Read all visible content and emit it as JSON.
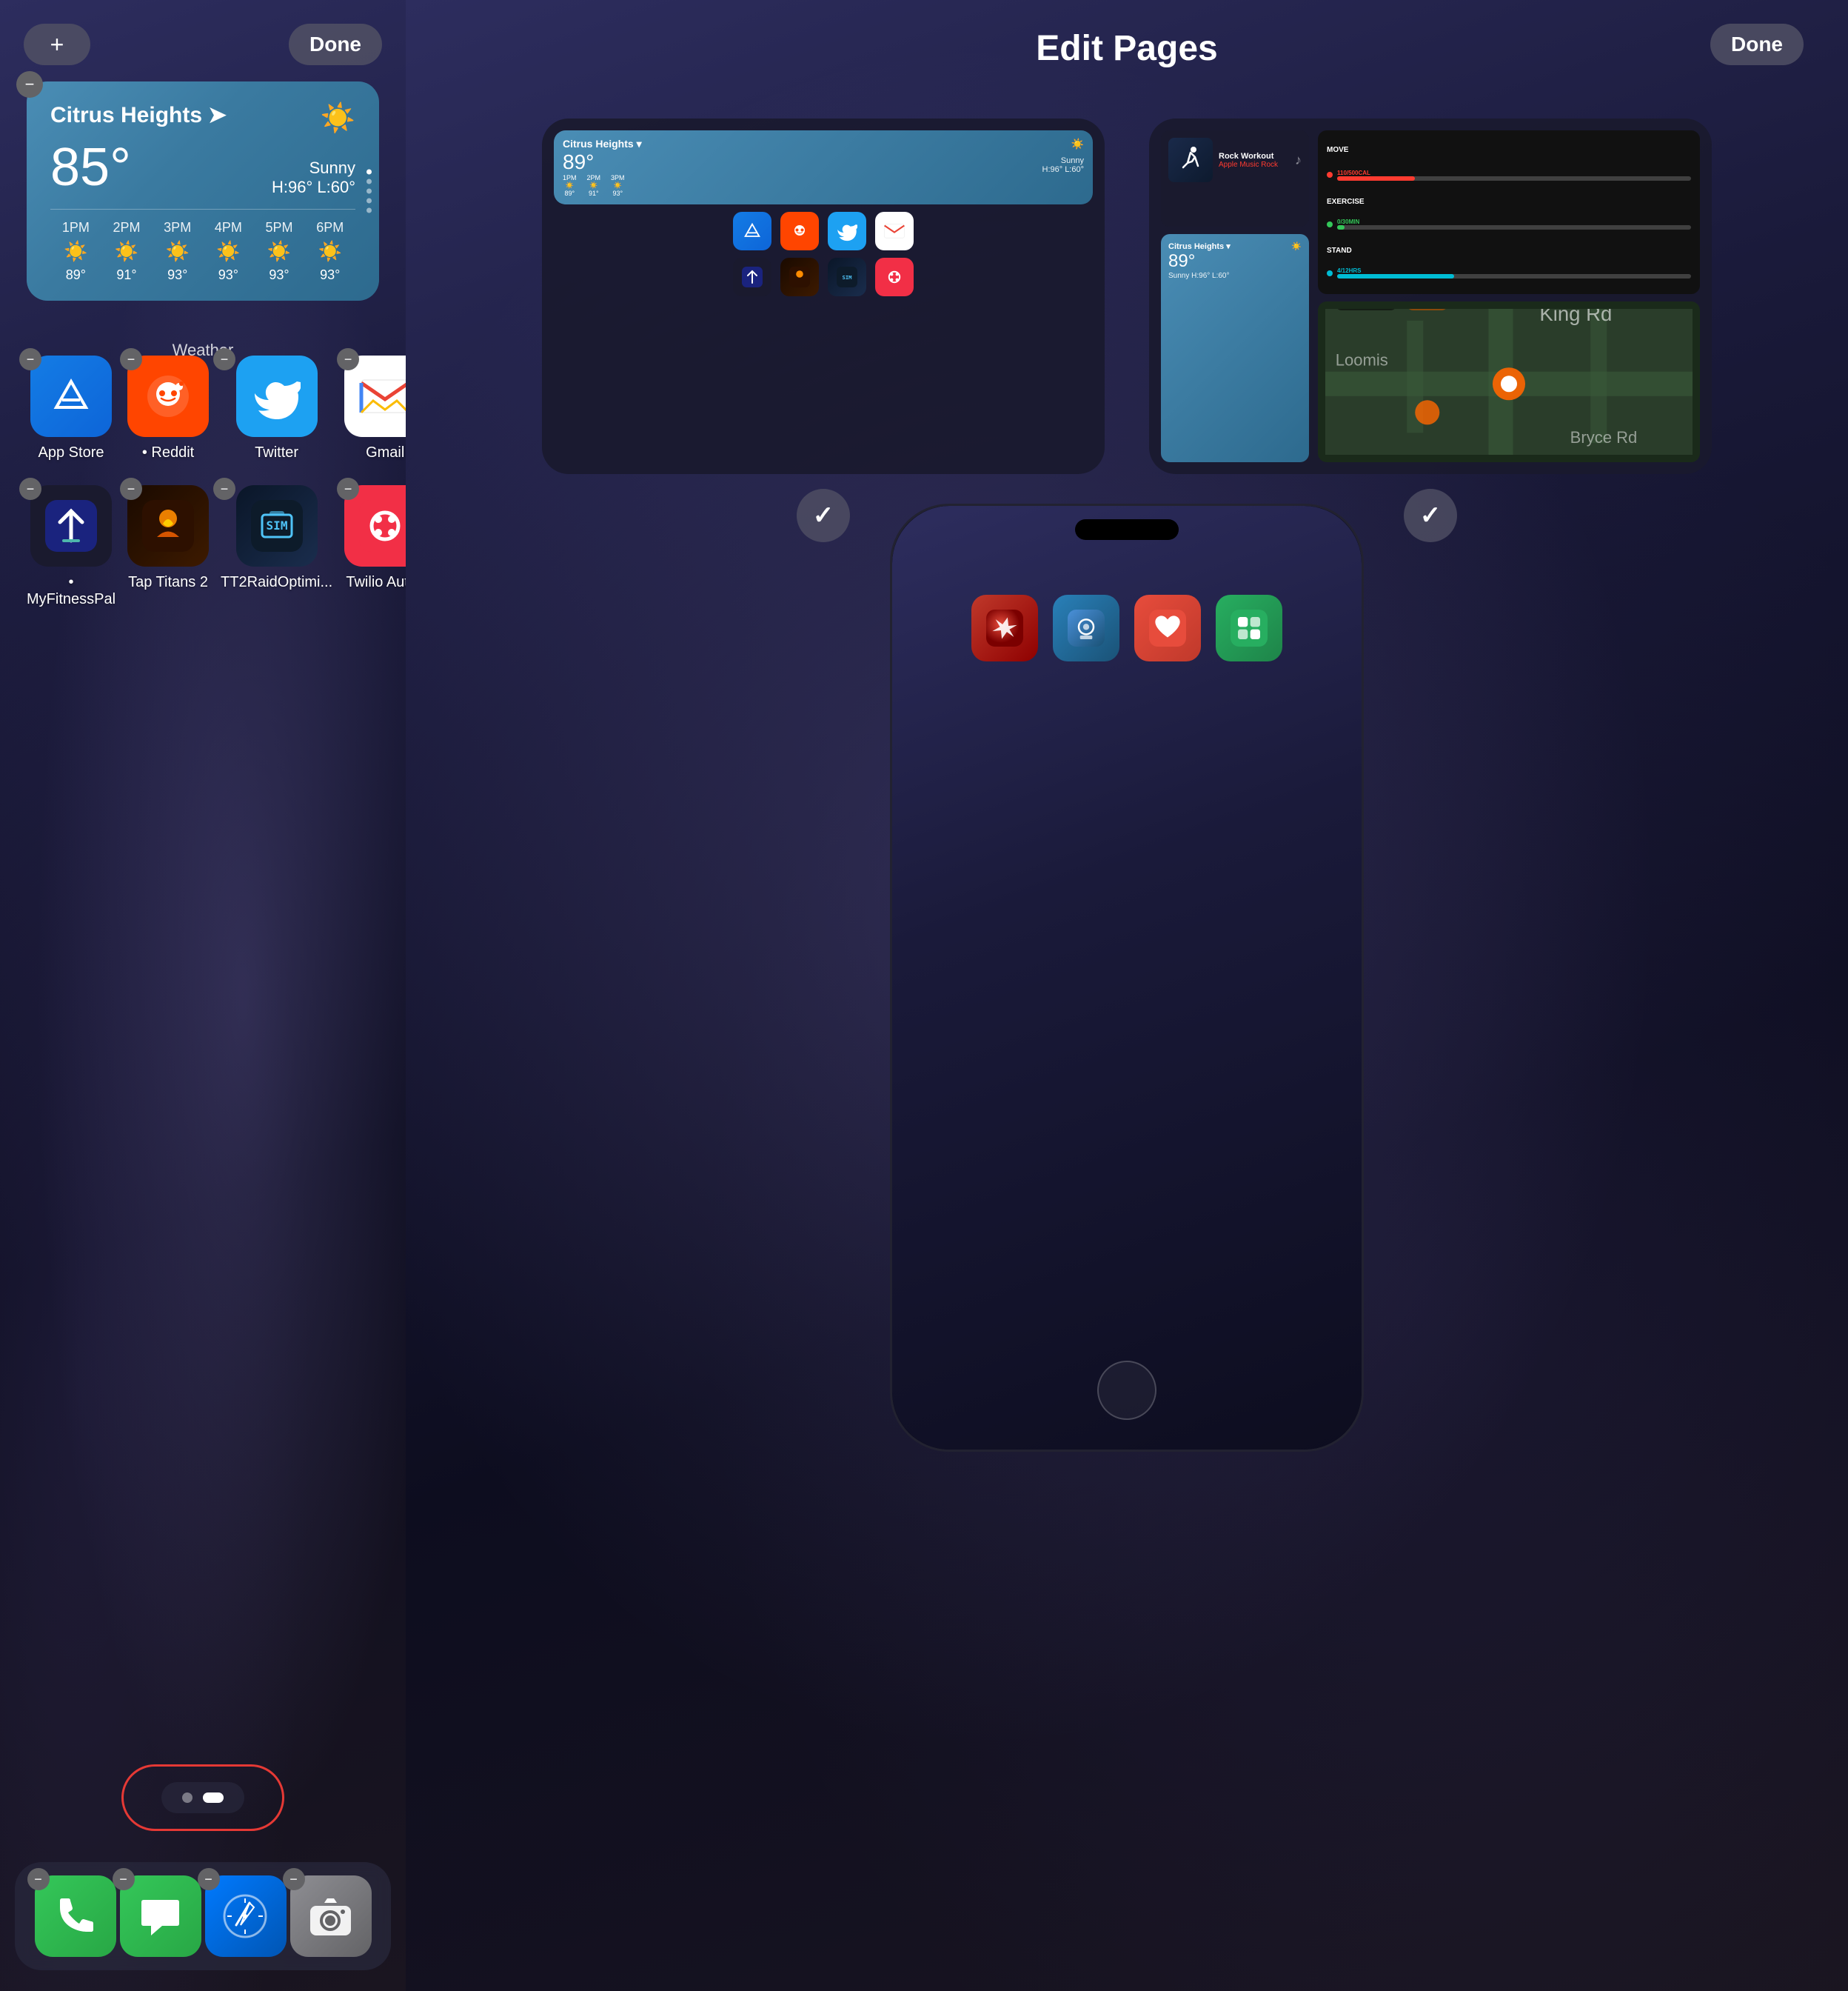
{
  "left": {
    "add_label": "+",
    "done_label": "Done",
    "weather": {
      "city": "Citrus Heights",
      "temp": "85°",
      "condition": "Sunny",
      "high_low": "H:96° L:60°",
      "label": "Weather",
      "hourly": [
        {
          "time": "1PM",
          "temp": "89°"
        },
        {
          "time": "2PM",
          "temp": "91°"
        },
        {
          "time": "3PM",
          "temp": "93°"
        },
        {
          "time": "4PM",
          "temp": "93°"
        },
        {
          "time": "5PM",
          "temp": "93°"
        },
        {
          "time": "6PM",
          "temp": "93°"
        }
      ]
    },
    "apps_row1": [
      {
        "id": "appstore",
        "label": "App Store"
      },
      {
        "id": "reddit",
        "label": "Reddit"
      },
      {
        "id": "twitter",
        "label": "Twitter"
      },
      {
        "id": "gmail",
        "label": "Gmail"
      }
    ],
    "apps_row2": [
      {
        "id": "myfitness",
        "label": "MyFitnessPal"
      },
      {
        "id": "taptitans",
        "label": "Tap Titans 2"
      },
      {
        "id": "tt2raid",
        "label": "TT2RaidOptimi..."
      },
      {
        "id": "twilio",
        "label": "Twilio Authy"
      }
    ],
    "dock": [
      {
        "id": "phone",
        "label": "Phone"
      },
      {
        "id": "messages",
        "label": "Messages"
      },
      {
        "id": "safari",
        "label": "Safari"
      },
      {
        "id": "camera",
        "label": "Camera"
      }
    ],
    "page_dots": [
      {
        "active": true
      },
      {
        "active": false
      }
    ]
  },
  "right": {
    "done_label": "Done",
    "title": "Edit Pages",
    "pages": [
      {
        "id": "page1",
        "checked": true,
        "weather_city": "Citrus Heights ▾",
        "weather_temp": "89°",
        "weather_condition": "Sunny H:96° L:60°"
      },
      {
        "id": "page2",
        "checked": true,
        "music_title": "Rock Workout",
        "music_subtitle": "Apple Music Rock",
        "weather_city": "Citrus Heights ▾",
        "weather_temp": "89°",
        "weather_condition": "Sunny H:96° L:60°",
        "activity_move": "110/500CAL",
        "activity_exercise": "0/30MIN",
        "activity_stand": "4/12HRS"
      }
    ],
    "phone_apps": [
      {
        "id": "nova"
      },
      {
        "id": "ring"
      },
      {
        "id": "health"
      },
      {
        "id": "widgetkit"
      }
    ]
  }
}
